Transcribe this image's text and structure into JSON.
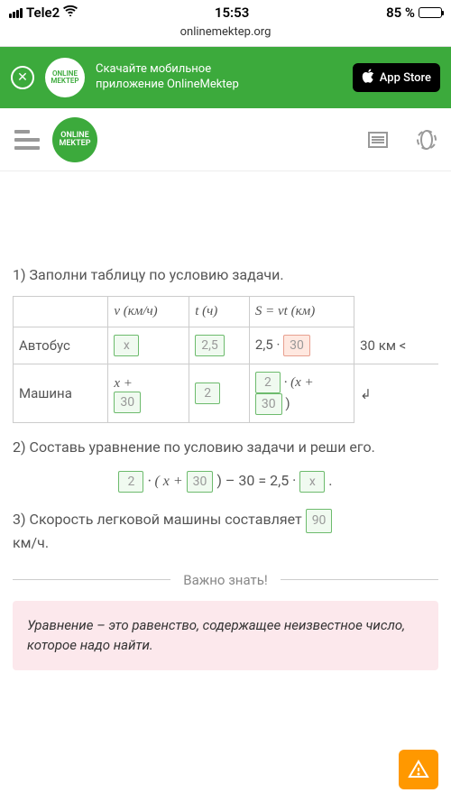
{
  "status": {
    "carrier": "Tele2",
    "time": "15:53",
    "battery_pct": "85 %"
  },
  "url": "onlinemektep.org",
  "promo": {
    "logo_text": "ONLINE\nMEKTEP",
    "line1": "Скачайте мобильное",
    "line2": "приложение OnlineMektep",
    "appstore": "App Store"
  },
  "header": {
    "logo_text": "ONLINE\nMEKTEP"
  },
  "question1": {
    "text": "1) Заполни таблицу по условию задачи.",
    "col_v": "v (км/ч)",
    "col_t": "t (ч)",
    "col_s": "S = vt (км)",
    "row1_label": "Автобус",
    "row1_v": "x",
    "row1_t": "2,5",
    "row1_s_prefix": "2,5 ·",
    "row1_s_val": "30",
    "row1_extra": "30 км <",
    "row2_label": "Машина",
    "row2_v_prefix": "x +",
    "row2_v_val": "30",
    "row2_t": "2",
    "row2_s_a": "2",
    "row2_s_mid": "· (x +",
    "row2_s_b": "30",
    "row2_s_close": ")",
    "row2_extra": "↲"
  },
  "question2": {
    "text": "2) Составь уравнение по условию задачи и реши его.",
    "eq_a": "2",
    "eq_b": "· ( x +",
    "eq_c": "30",
    "eq_d": ") – 30 = 2,5 ·",
    "eq_e": "x",
    "eq_f": "."
  },
  "question3": {
    "text_before": "3) Скорость легковой машины составляет",
    "value": "90",
    "text_after": " км/ч."
  },
  "divider": "Важно знать!",
  "info": "Уравнение – это равенство, содержащее неизвестное число, которое надо найти."
}
